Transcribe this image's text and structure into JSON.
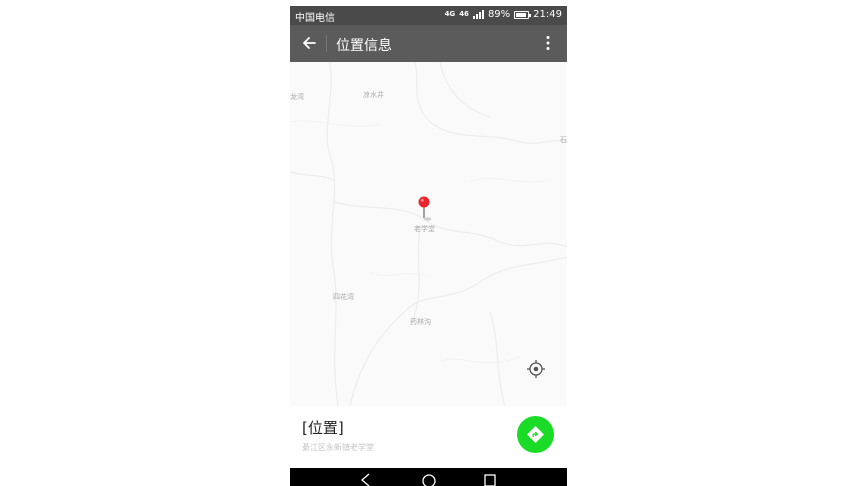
{
  "status_bar": {
    "carrier": "中国电信",
    "network": "4G",
    "network_sub": "46",
    "battery": "89%",
    "time": "21:49"
  },
  "app_bar": {
    "title": "位置信息",
    "back_icon": "arrow-left-icon",
    "menu_icon": "more-vertical-icon"
  },
  "map": {
    "labels": [
      {
        "text": "龙湾"
      },
      {
        "text": "凉水井"
      },
      {
        "text": "石"
      },
      {
        "text": "老学堂"
      },
      {
        "text": "四花湾"
      },
      {
        "text": "药林沟"
      }
    ]
  },
  "location": {
    "name": "[位置]",
    "address": "綦江区永新镇老学堂"
  },
  "colors": {
    "app_bar": "#5b5b5b",
    "status_bar": "#4a4a4a",
    "nav_button": "#1adb25",
    "pin": "#e8262b"
  }
}
